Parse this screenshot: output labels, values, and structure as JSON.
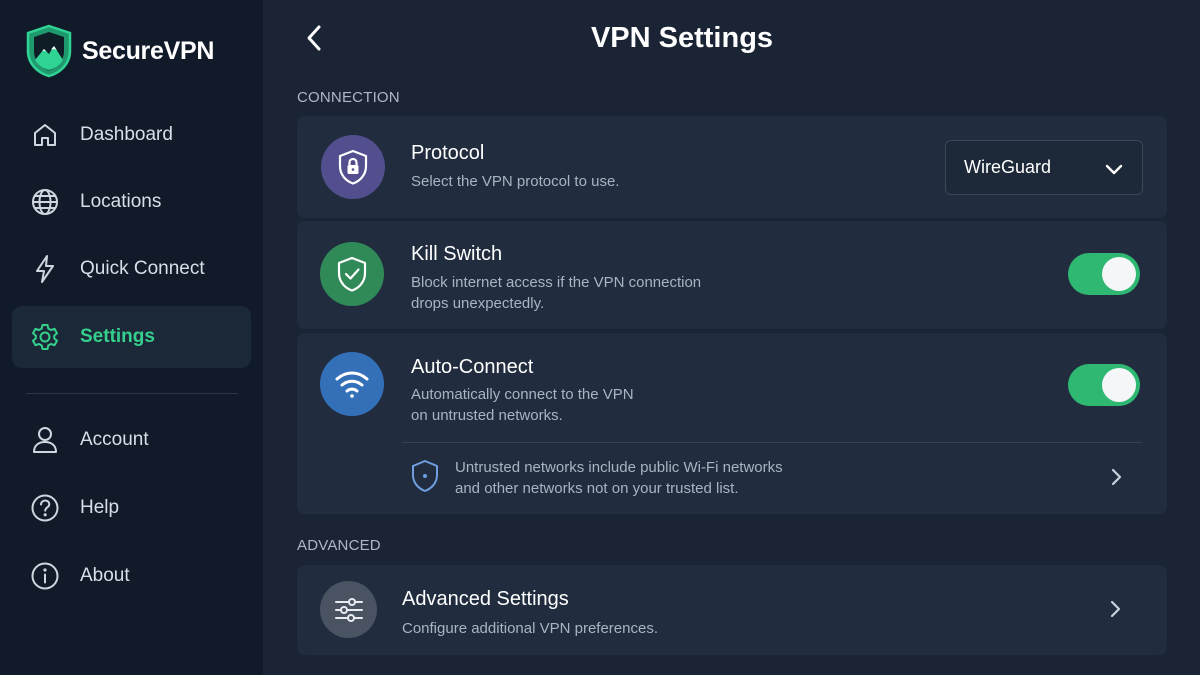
{
  "brand": {
    "name": "SecureVPN",
    "accent": "#2fc48a"
  },
  "nav": {
    "items": [
      {
        "label": "Dashboard",
        "icon": "home-icon"
      },
      {
        "label": "Locations",
        "icon": "globe-icon"
      },
      {
        "label": "Quick Connect",
        "icon": "lightning-icon"
      },
      {
        "label": "Settings",
        "icon": "gear-icon",
        "active": true
      },
      {
        "label": "Account",
        "icon": "user-icon"
      },
      {
        "label": "Help",
        "icon": "help-icon"
      },
      {
        "label": "About",
        "icon": "info-icon"
      }
    ]
  },
  "page": {
    "title": "VPN Settings"
  },
  "sections": {
    "connection": "CONNECTION",
    "advanced": "ADVANCED"
  },
  "protocol": {
    "title": "Protocol",
    "desc": "Select the VPN protocol to use.",
    "selected": "WireGuard",
    "icon": "shield-lock-icon",
    "icon_color": "#534f8e"
  },
  "kill_switch": {
    "title": "Kill Switch",
    "desc_line1": "Block internet access if the VPN connection",
    "desc_line2": "drops unexpectedly.",
    "enabled": true,
    "icon": "shield-check-icon",
    "icon_color": "#2f8a58"
  },
  "auto_connect": {
    "title": "Auto-Connect",
    "desc_line1": "Automatically connect to the VPN",
    "desc_line2": "on untrusted networks.",
    "enabled": true,
    "icon": "wifi-icon",
    "icon_color": "#3470b8",
    "note_line1": "Untrusted networks include public Wi-Fi networks",
    "note_line2": "and other networks not on your trusted list."
  },
  "advanced_settings": {
    "title": "Advanced Settings",
    "desc": "Configure additional VPN preferences.",
    "icon": "sliders-icon",
    "icon_color": "#4a5361"
  },
  "colors": {
    "toggle_on": "#2fb872",
    "active_nav_text": "#35d08c"
  }
}
